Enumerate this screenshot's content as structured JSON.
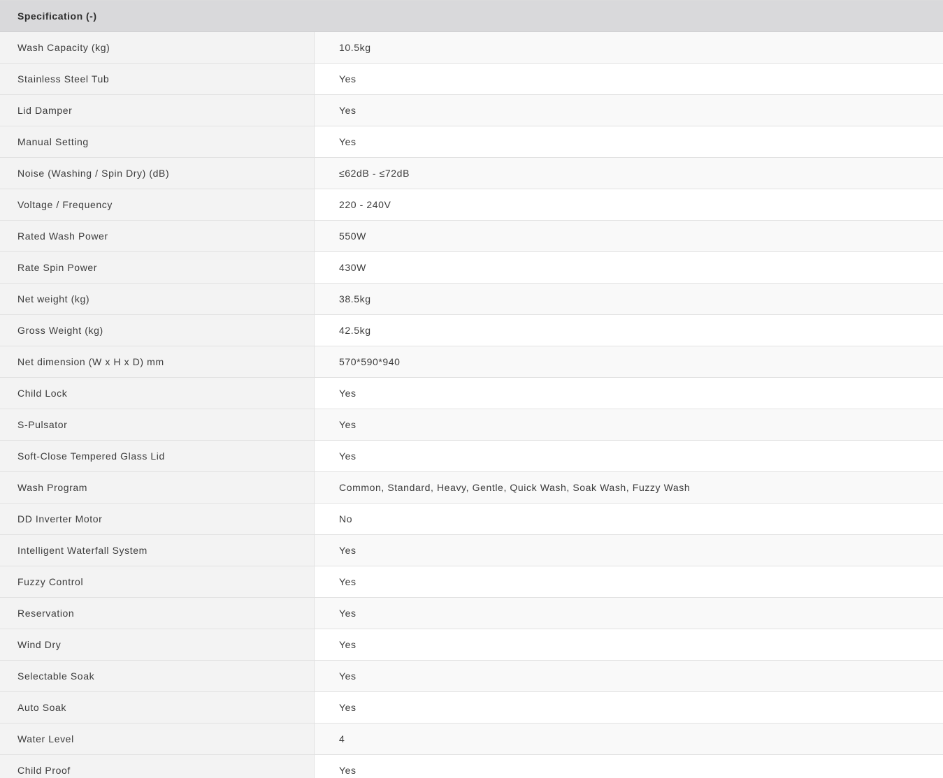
{
  "section": {
    "title": "Specification (-)"
  },
  "specs": [
    {
      "label": "Wash Capacity (kg)",
      "value": "10.5kg"
    },
    {
      "label": "Stainless Steel Tub",
      "value": "Yes"
    },
    {
      "label": "Lid Damper",
      "value": "Yes"
    },
    {
      "label": "Manual Setting",
      "value": "Yes"
    },
    {
      "label": "Noise (Washing / Spin Dry) (dB)",
      "value": "≤62dB - ≤72dB"
    },
    {
      "label": "Voltage / Frequency",
      "value": "220 - 240V"
    },
    {
      "label": "Rated Wash Power",
      "value": "550W"
    },
    {
      "label": "Rate Spin Power",
      "value": "430W"
    },
    {
      "label": "Net weight (kg)",
      "value": "38.5kg"
    },
    {
      "label": "Gross Weight (kg)",
      "value": "42.5kg"
    },
    {
      "label": "Net dimension (W x H x D) mm",
      "value": "570*590*940"
    },
    {
      "label": "Child Lock",
      "value": "Yes"
    },
    {
      "label": "S-Pulsator",
      "value": "Yes"
    },
    {
      "label": "Soft-Close Tempered Glass Lid",
      "value": "Yes"
    },
    {
      "label": "Wash Program",
      "value": "Common, Standard, Heavy, Gentle, Quick Wash, Soak Wash, Fuzzy Wash"
    },
    {
      "label": "DD Inverter Motor",
      "value": "No"
    },
    {
      "label": "Intelligent Waterfall System",
      "value": "Yes"
    },
    {
      "label": "Fuzzy Control",
      "value": "Yes"
    },
    {
      "label": "Reservation",
      "value": "Yes"
    },
    {
      "label": "Wind Dry",
      "value": "Yes"
    },
    {
      "label": "Selectable Soak",
      "value": "Yes"
    },
    {
      "label": "Auto Soak",
      "value": "Yes"
    },
    {
      "label": "Water Level",
      "value": "4"
    },
    {
      "label": "Child Proof",
      "value": "Yes"
    }
  ]
}
